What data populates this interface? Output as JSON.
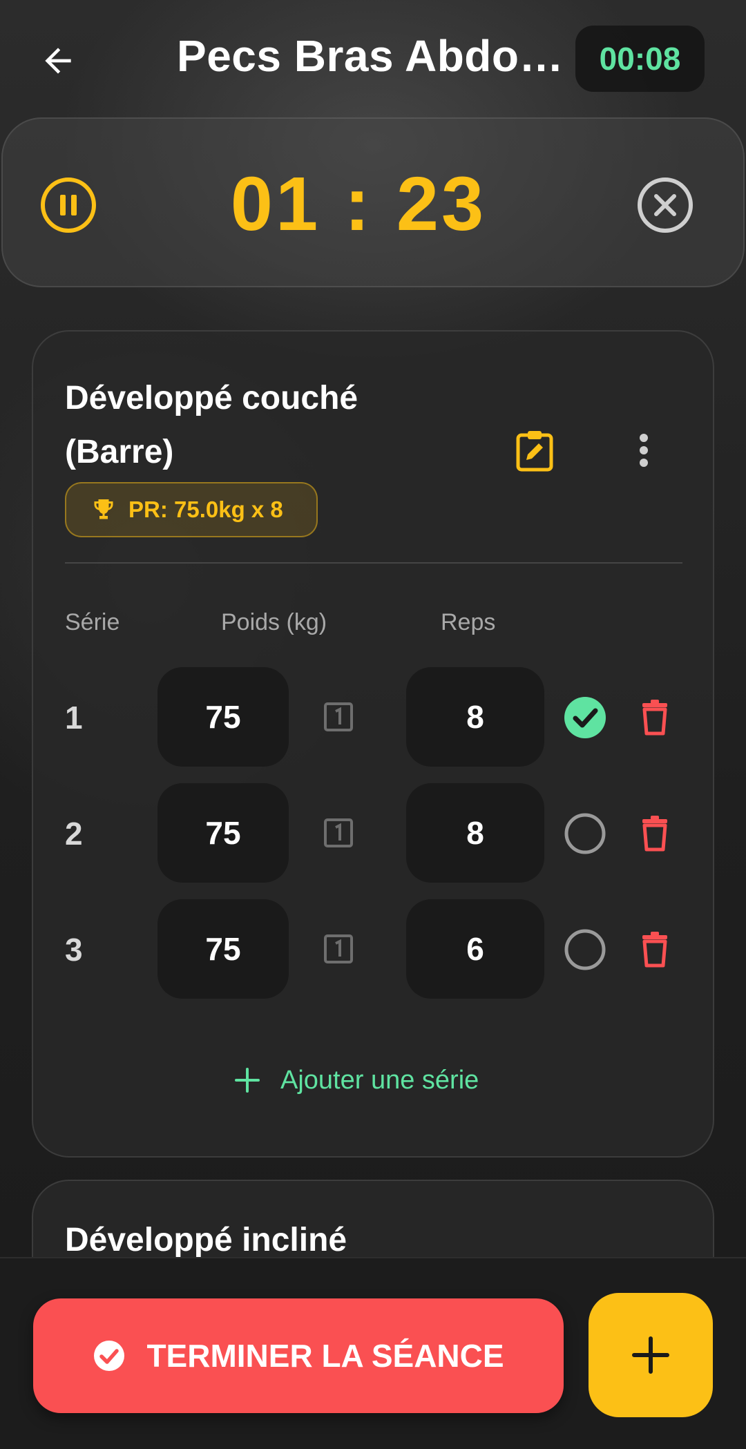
{
  "header": {
    "title": "Pecs Bras Abdos Dos",
    "elapsed_time": "00:08",
    "back_icon": "arrow-left-icon"
  },
  "rest_timer": {
    "value": "01 : 23",
    "pause_icon": "pause-circle-icon",
    "close_icon": "close-circle-icon"
  },
  "exercise": {
    "name_line1": "Développé couché",
    "name_line2": "(Barre)",
    "pr_label": "PR: 75.0kg x 8",
    "columns": {
      "set": "Série",
      "weight": "Poids (kg)",
      "reps": "Reps"
    },
    "sets": [
      {
        "num": "1",
        "weight": "75",
        "reps": "8",
        "done": true
      },
      {
        "num": "2",
        "weight": "75",
        "reps": "8",
        "done": false
      },
      {
        "num": "3",
        "weight": "75",
        "reps": "6",
        "done": false
      }
    ],
    "add_set_label": "Ajouter une série"
  },
  "next_exercise": {
    "name": "Développé incliné"
  },
  "bottom": {
    "finish_label": "TERMINER LA SÉANCE"
  },
  "colors": {
    "accent_yellow": "#fcc016",
    "accent_green": "#5fe3a1",
    "danger_red": "#fa5052"
  }
}
